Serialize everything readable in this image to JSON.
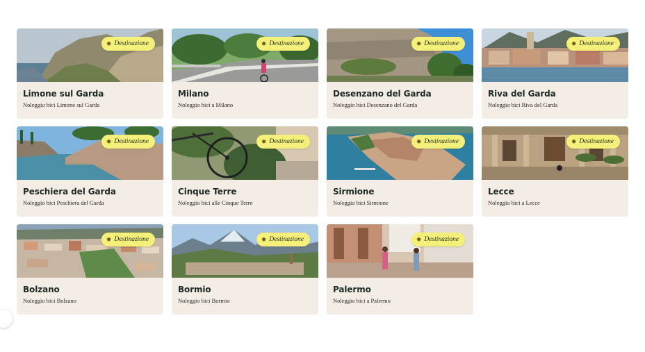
{
  "badge_label": "Destinazione",
  "badge_icon": "sun-icon",
  "colors": {
    "card_background": "#f4ede6",
    "badge_background": "#f4f07a",
    "title_text": "#1d2a24"
  },
  "cards": [
    {
      "title": "Limone sul Garda",
      "subtitle": "Noleggio bici Limone sul Garda",
      "image": "lake-mountain-photo"
    },
    {
      "title": "Milano",
      "subtitle": "Noleggio bici a Milano",
      "image": "cyclist-road-photo"
    },
    {
      "title": "Desenzano del Garda",
      "subtitle": "Noleggio bici Desenzano del Garda",
      "image": "stone-wall-photo"
    },
    {
      "title": "Riva del Garda",
      "subtitle": "Noleggio bici Riva del Garda",
      "image": "lakeside-town-photo"
    },
    {
      "title": "Peschiera del Garda",
      "subtitle": "Noleggio bici Peschiera del Garda",
      "image": "canal-fortress-photo"
    },
    {
      "title": "Cinque Terre",
      "subtitle": "Noleggio bici alle Cinque Terre",
      "image": "bicycle-wheel-photo"
    },
    {
      "title": "Sirmione",
      "subtitle": "Noleggio bici Sirmione",
      "image": "peninsula-aerial-photo"
    },
    {
      "title": "Lecce",
      "subtitle": "Noleggio bici a Lecce",
      "image": "baroque-building-photo"
    },
    {
      "title": "Bolzano",
      "subtitle": "Noleggio bici Bolzano",
      "image": "city-aerial-photo"
    },
    {
      "title": "Bormio",
      "subtitle": "Noleggio bici Bormio",
      "image": "alpine-valley-photo"
    },
    {
      "title": "Palermo",
      "subtitle": "Noleggio bici a Palermo",
      "image": "street-cyclists-photo"
    }
  ]
}
